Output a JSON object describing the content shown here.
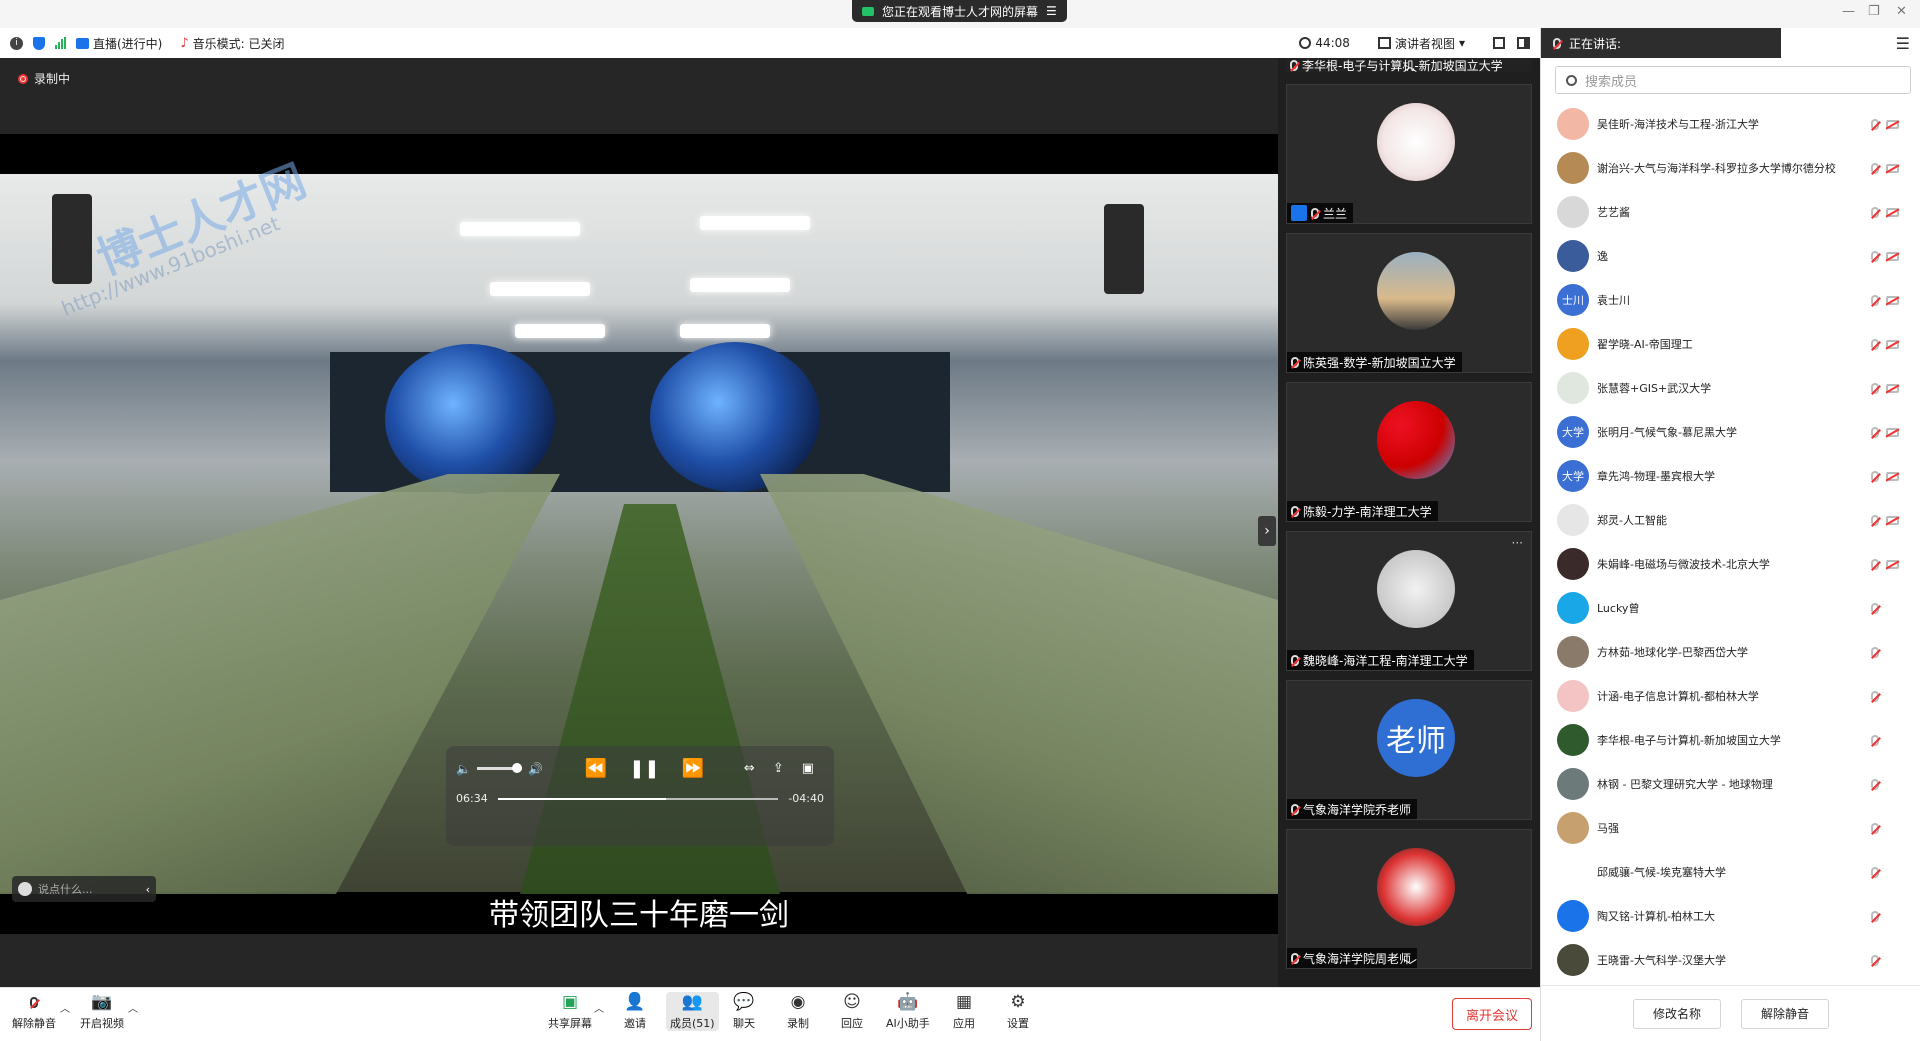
{
  "window": {
    "share_banner": "您正在观看博士人才网的屏幕",
    "share_menu_icon": "menu-icon",
    "controls": [
      "minimize-icon",
      "restore-icon",
      "close-icon"
    ]
  },
  "infobar": {
    "live_label": "直播(进行中)",
    "music_label": "音乐模式: 已关闭",
    "timer": "44:08",
    "view_label": "演讲者视图"
  },
  "main": {
    "recording_label": "录制中",
    "watermark_title": "博士人才网",
    "watermark_url": "http://www.91boshi.net",
    "subtitle": "带领团队三十年磨一剑",
    "player": {
      "elapsed": "06:34",
      "remaining": "-04:40",
      "progress_fraction": 0.6,
      "volume_fraction": 0.9
    },
    "chat_placeholder": "说点什么...",
    "colors": {
      "background": "#262626",
      "accent": "#1a73e8",
      "danger": "#e53935"
    }
  },
  "thumbs": {
    "top_partial_label": "李华根-电子与计算机-新加坡国立大学",
    "items": [
      {
        "label": "兰兰",
        "avatar_text": ""
      },
      {
        "label": "陈英强-数学-新加坡国立大学",
        "avatar_text": ""
      },
      {
        "label": "陈毅-力学-南洋理工大学",
        "avatar_text": ""
      },
      {
        "label": "魏晓峰-海洋工程-南洋理工大学",
        "avatar_text": ""
      },
      {
        "label": "气象海洋学院乔老师",
        "avatar_text": "老师"
      },
      {
        "label": "气象海洋学院周老师",
        "avatar_text": ""
      }
    ]
  },
  "panel": {
    "speaking_label": "正在讲话:",
    "search_placeholder": "搜索成员",
    "members": [
      {
        "name": "吴佳昕-海洋技术与工程-浙江大学",
        "avatar_text": "",
        "color": "#f3b7a5",
        "video_off": true
      },
      {
        "name": "谢治兴-大气与海洋科学-科罗拉多大学博尔德分校",
        "avatar_text": "",
        "color": "#b58a55",
        "video_off": true
      },
      {
        "name": "艺艺酱",
        "avatar_text": "",
        "color": "#d8d8d8",
        "video_off": true
      },
      {
        "name": "逸",
        "avatar_text": "",
        "color": "#3a5c9a",
        "video_off": true
      },
      {
        "name": "袁士川",
        "avatar_text": "士川",
        "color": "#3b6fd3",
        "video_off": true
      },
      {
        "name": "翟学晓-AI-帝国理工",
        "avatar_text": "",
        "color": "#f0a020",
        "video_off": true
      },
      {
        "name": "张慧蓉+GIS+武汉大学",
        "avatar_text": "",
        "color": "#dfe7df",
        "video_off": true
      },
      {
        "name": "张明月-气候气象-慕尼黑大学",
        "avatar_text": "大学",
        "color": "#3b6fd3",
        "video_off": true
      },
      {
        "name": "章先鸿-物理-墨宾根大学",
        "avatar_text": "大学",
        "color": "#3b6fd3",
        "video_off": true
      },
      {
        "name": "郑灵-人工智能",
        "avatar_text": "",
        "color": "#e6e6e6",
        "video_off": true
      },
      {
        "name": "朱娟峰-电磁场与微波技术-北京大学",
        "avatar_text": "",
        "color": "#3a2a2a",
        "video_off": true
      },
      {
        "name": "Lucky曾",
        "avatar_text": "",
        "color": "#1aa7e8",
        "video_off": false
      },
      {
        "name": "方林茹-地球化学-巴黎西岱大学",
        "avatar_text": "",
        "color": "#8a7a6a",
        "video_off": false
      },
      {
        "name": "计涵-电子信息计算机-都柏林大学",
        "avatar_text": "",
        "color": "#f4c3c3",
        "video_off": false
      },
      {
        "name": "李华根-电子与计算机-新加坡国立大学",
        "avatar_text": "",
        "color": "#2e5a2e",
        "video_off": false
      },
      {
        "name": "林钢 - 巴黎文理研究大学 - 地球物理",
        "avatar_text": "",
        "color": "#6c7a7a",
        "video_off": false
      },
      {
        "name": "马强",
        "avatar_text": "",
        "color": "#c7a070",
        "video_off": false
      },
      {
        "name": "邱威骧-气候-埃克塞特大学",
        "avatar_text": "",
        "color": "#ffffff",
        "video_off": false
      },
      {
        "name": "陶又铭-计算机-柏林工大",
        "avatar_text": "",
        "color": "#1a73e8",
        "video_off": false
      },
      {
        "name": "王晓雷-大气科学-汉堡大学",
        "avatar_text": "",
        "color": "#4a4a3a",
        "video_off": false
      }
    ],
    "rename_button": "修改名称",
    "unmute_button": "解除静音"
  },
  "toolbar": {
    "unmute": "解除静音",
    "start_video": "开启视频",
    "share_screen": "共享屏幕",
    "invite": "邀请",
    "members": "成员(51)",
    "chat": "聊天",
    "record": "录制",
    "react": "回应",
    "ai_assistant": "AI小助手",
    "apps": "应用",
    "settings": "设置",
    "leave": "离开会议"
  }
}
